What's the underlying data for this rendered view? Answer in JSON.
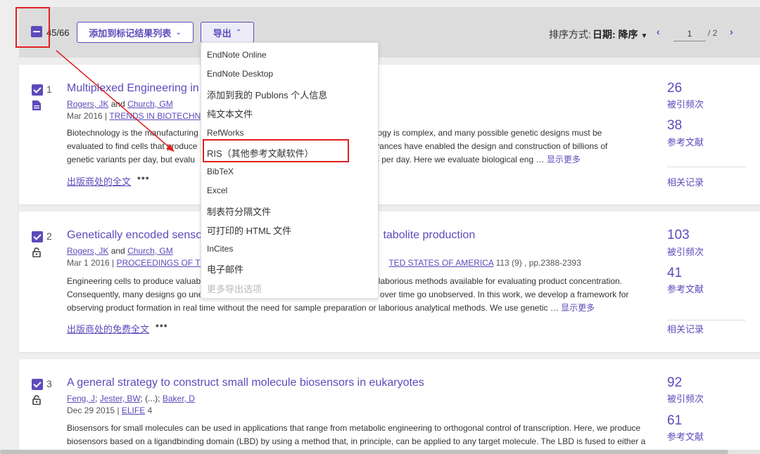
{
  "toolbar": {
    "selected_count": "45/66",
    "add_to_marked_label": "添加到标记结果列表",
    "export_label": "导出",
    "sort_label": "排序方式:",
    "sort_value": "日期: 降序",
    "page_current": "1",
    "page_total": "/ 2"
  },
  "export_menu": {
    "items": [
      "EndNote Online",
      "EndNote Desktop",
      "添加到我的 Publons 个人信息",
      "纯文本文件",
      "RefWorks",
      "RIS（其他参考文献软件）",
      "BibTeX",
      "Excel",
      "制表符分隔文件",
      "可打印的 HTML 文件",
      "InCites",
      "电子邮件",
      "更多导出选项"
    ]
  },
  "records": [
    {
      "num": "1",
      "title": "Multiplexed Engineering in B",
      "authors_a": "Rogers, JK",
      "authors_and": "and",
      "authors_b": "Church, GM",
      "date": "Mar 2016",
      "sep": "|",
      "journal": "TRENDS IN BIOTECHNOL",
      "abstract_1": "Biotechnology is the manufacturing",
      "abstract_1b": "g biology is complex, and many possible genetic designs must be",
      "abstract_2": "evaluated to find cells that produce",
      "abstract_2b": "nt advances have enabled the design and construction of billions of",
      "abstract_3": "genetic variants per day, but evalu",
      "abstract_3b": "ariants per day. Here we evaluate biological eng …",
      "more": "显示更多",
      "fulltext": "出版商处的全文",
      "dots": "•••",
      "citations": "26",
      "citations_label": "被引频次",
      "references": "38",
      "references_label": "参考文献",
      "related": "相关记录"
    },
    {
      "num": "2",
      "title": "Genetically encoded sensor",
      "title_b": "tabolite production",
      "authors_a": "Rogers, JK",
      "authors_and": "and",
      "authors_b": "Church, GM",
      "date": "Mar 1 2016",
      "sep": "|",
      "journal": "PROCEEDINGS OF THE",
      "journal_b": "TED STATES OF AMERICA",
      "vol": "113 (9) , pp.2388-2393",
      "abstract_1": "Engineering cells to produce valuab",
      "abstract_1b": "nd laborious methods available for evaluating product concentration.",
      "abstract_2": "Consequently, many designs go une",
      "abstract_2b": "on over time go unobserved. In this work, we develop a framework for",
      "abstract_3": "observing product formation in real time without the need for sample preparation or laborious analytical methods. We use genetic …",
      "more": "显示更多",
      "fulltext": "出版商处的免费全文",
      "dots": "•••",
      "citations": "103",
      "citations_label": "被引频次",
      "references": "41",
      "references_label": "参考文献",
      "related": "相关记录"
    },
    {
      "num": "3",
      "title": "A general strategy to construct small molecule biosensors in eukaryotes",
      "authors_a": "Feng, J",
      "authors_semi1": ";",
      "authors_b": "Jester, BW",
      "authors_mid": "; (...);",
      "authors_c": "Baker, D",
      "date": "Dec 29 2015",
      "sep": "|",
      "journal": "ELIFE",
      "vol": "4",
      "abstract_1": "Biosensors for small molecules can be used in applications that range from metabolic engineering to orthogonal control of transcription. Here, we produce",
      "abstract_2": "biosensors based on a ligandbinding domain (LBD) by using a method that, in principle, can be applied to any target molecule. The LBD is fused to either a",
      "citations": "92",
      "citations_label": "被引频次",
      "references": "61",
      "references_label": "参考文献"
    }
  ],
  "colors": {
    "accent": "#5b4bbb",
    "annotation_red": "#e02020"
  }
}
